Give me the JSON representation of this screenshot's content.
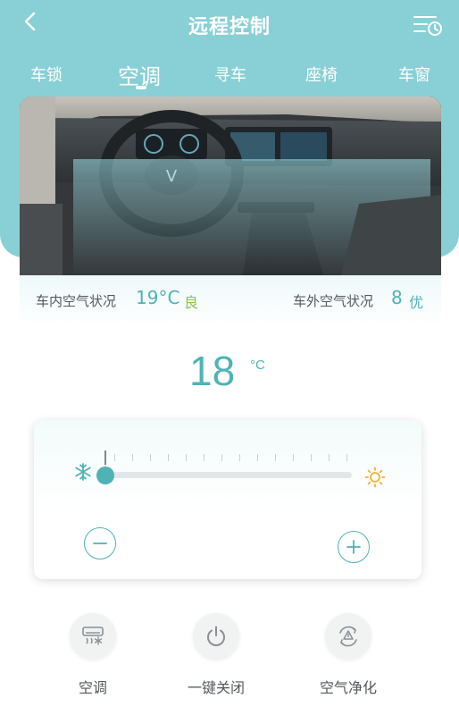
{
  "header": {
    "title": "远程控制"
  },
  "tabs": [
    {
      "label": "车锁"
    },
    {
      "label": "空调"
    },
    {
      "label": "寻车"
    },
    {
      "label": "座椅"
    },
    {
      "label": "车窗"
    }
  ],
  "active_tab": "空调",
  "air_quality": {
    "inside_label": "车内空气状况",
    "inside_value": "19°C",
    "inside_grade": "良",
    "outside_label": "车外空气状况",
    "outside_value": "8",
    "outside_grade": "优"
  },
  "temperature": {
    "value": "18",
    "unit": "°C"
  },
  "slider": {
    "level": 0
  },
  "actions": [
    {
      "label": "空调",
      "icon": "ac-icon"
    },
    {
      "label": "一键关闭",
      "icon": "power-icon"
    },
    {
      "label": "空气净化",
      "icon": "air-purify-icon"
    }
  ],
  "colors": {
    "header_bg": "#88d0d5",
    "accent": "#4fb3b6",
    "grade_good": "#8cc34a",
    "sun": "#f1b233"
  }
}
